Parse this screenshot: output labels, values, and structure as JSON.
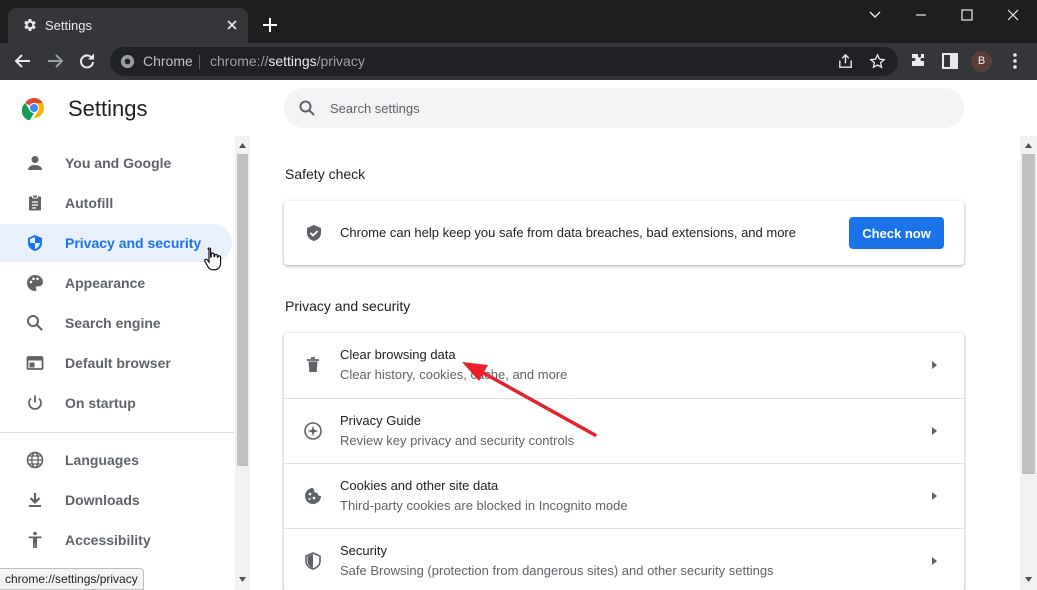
{
  "tab": {
    "title": "Settings"
  },
  "omnibox": {
    "site_chip": "Chrome",
    "url_scheme": "chrome://",
    "url_host": "settings",
    "url_path": "/privacy"
  },
  "profile": {
    "initial": "B"
  },
  "app": {
    "title": "Settings"
  },
  "search": {
    "placeholder": "Search settings"
  },
  "sidebar": {
    "items": [
      {
        "label": "You and Google",
        "icon": "person-icon"
      },
      {
        "label": "Autofill",
        "icon": "clipboard-icon"
      },
      {
        "label": "Privacy and security",
        "icon": "shield-icon",
        "active": true
      },
      {
        "label": "Appearance",
        "icon": "palette-icon"
      },
      {
        "label": "Search engine",
        "icon": "search-icon"
      },
      {
        "label": "Default browser",
        "icon": "browser-window-icon"
      },
      {
        "label": "On startup",
        "icon": "power-icon"
      },
      {
        "label": "Languages",
        "icon": "globe-icon"
      },
      {
        "label": "Downloads",
        "icon": "download-icon"
      },
      {
        "label": "Accessibility",
        "icon": "accessibility-icon"
      }
    ]
  },
  "safety_check": {
    "heading": "Safety check",
    "text": "Chrome can help keep you safe from data breaches, bad extensions, and more",
    "button": "Check now"
  },
  "privacy": {
    "heading": "Privacy and security",
    "rows": [
      {
        "title": "Clear browsing data",
        "subtitle": "Clear history, cookies, cache, and more",
        "icon": "trash-icon"
      },
      {
        "title": "Privacy Guide",
        "subtitle": "Review key privacy and security controls",
        "icon": "compass-icon"
      },
      {
        "title": "Cookies and other site data",
        "subtitle": "Third-party cookies are blocked in Incognito mode",
        "icon": "cookie-icon"
      },
      {
        "title": "Security",
        "subtitle": "Safe Browsing (protection from dangerous sites) and other security settings",
        "icon": "shield-half-icon"
      }
    ]
  },
  "status": {
    "url": "chrome://settings/privacy"
  },
  "colors": {
    "accent": "#1a73e8",
    "active_bg": "#e8f0fe",
    "annotation": "#e8202a"
  }
}
